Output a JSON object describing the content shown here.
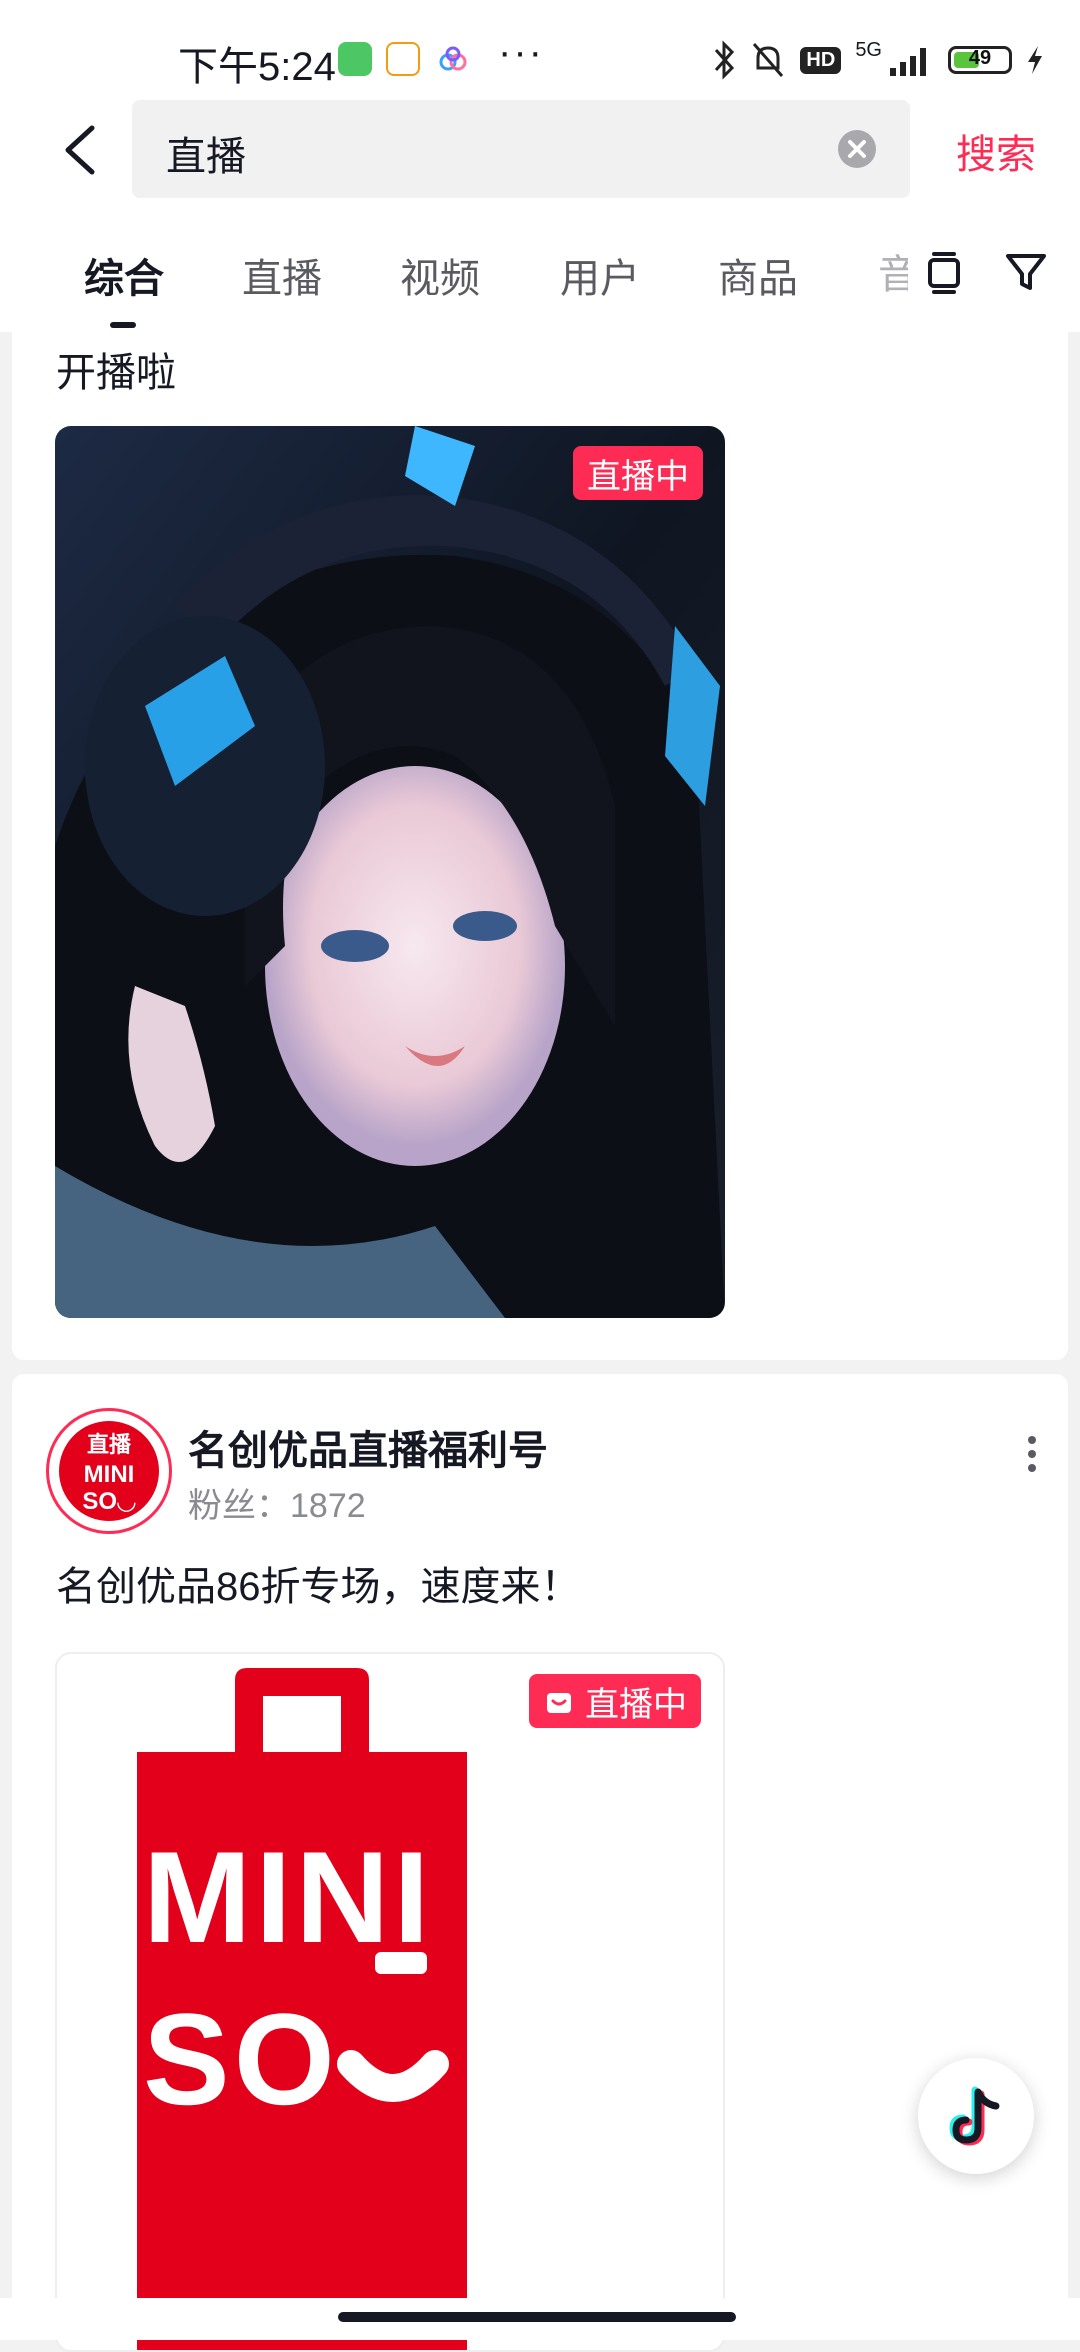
{
  "status_bar": {
    "time": "下午5:24",
    "network": "5G",
    "battery": "49",
    "battery_level": 0.49
  },
  "search": {
    "query": "直播",
    "submit_label": "搜索"
  },
  "tabs": [
    "综合",
    "直播",
    "视频",
    "用户",
    "商品"
  ],
  "tab_overflow_hint": "音",
  "active_tab_index": 0,
  "feed": {
    "card1": {
      "text": "开播啦",
      "badge": "直播中"
    },
    "card2": {
      "account_name": "名创优品直播福利号",
      "fans_label": "粉丝：",
      "fans_count": "1872",
      "text": "名创优品86折专场，速度来！",
      "badge": "直播中",
      "avatar_top_text": "直播",
      "avatar_logo_line1": "MINI",
      "avatar_logo_line2": "SO◡",
      "logo_line1": "MINI",
      "logo_line2": "SO"
    }
  },
  "colors": {
    "accent": "#fe2c55",
    "text_primary": "#161823",
    "text_secondary": "#8a8b91",
    "miniso_red": "#e2001a"
  }
}
